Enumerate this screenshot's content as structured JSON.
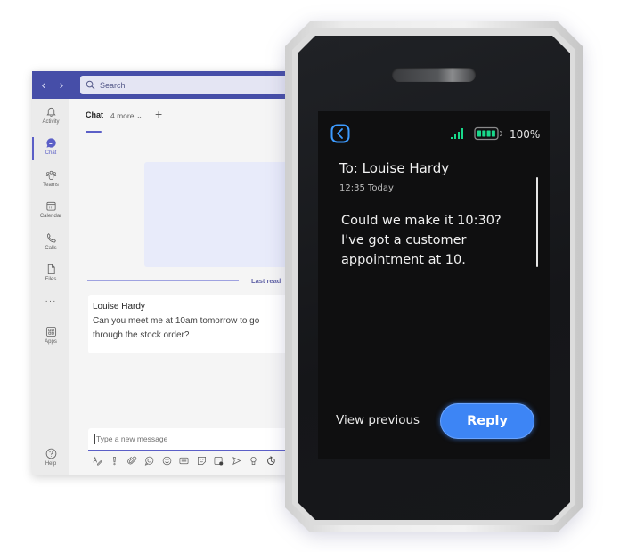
{
  "teams": {
    "nav": {
      "back": "‹",
      "forward": "›"
    },
    "search": {
      "placeholder": "Search",
      "icon": "search-icon"
    },
    "rail": {
      "items": [
        {
          "label": "Activity",
          "icon": "bell-icon"
        },
        {
          "label": "Chat",
          "icon": "chat-icon",
          "active": true
        },
        {
          "label": "Teams",
          "icon": "teams-icon"
        },
        {
          "label": "Calendar",
          "icon": "calendar-icon"
        },
        {
          "label": "Calls",
          "icon": "phone-icon"
        },
        {
          "label": "Files",
          "icon": "file-icon"
        },
        {
          "label": "Apps",
          "icon": "apps-icon"
        }
      ],
      "more": "···",
      "help": "Help"
    },
    "tabs": {
      "chat": "Chat",
      "more": "4 more ⌄",
      "add": "+"
    },
    "last_read": "Last read",
    "message": {
      "sender": "Louise Hardy",
      "body": "Can  you meet me at 10am tomorrow to go through the stock order?"
    },
    "composer": {
      "placeholder": "Type a new message",
      "tools": [
        "format-icon",
        "important-icon",
        "attach-icon",
        "loop-icon",
        "emoji-icon",
        "gif-icon",
        "sticker-icon",
        "schedule-meeting-icon",
        "stream-icon",
        "praise-icon",
        "updates-icon"
      ]
    },
    "accent": "#464ea8"
  },
  "device": {
    "status": {
      "battery": "100%",
      "signal_color": "#19d98b",
      "battery_color": "#19d98b"
    },
    "header": {
      "to": "To: Louise Hardy",
      "time": "12:35 Today"
    },
    "message": "Could we make it 10:30? I've got a customer appointment at 10.",
    "actions": {
      "view_previous": "View previous",
      "reply": "Reply"
    },
    "accent": "#3d85f5"
  }
}
